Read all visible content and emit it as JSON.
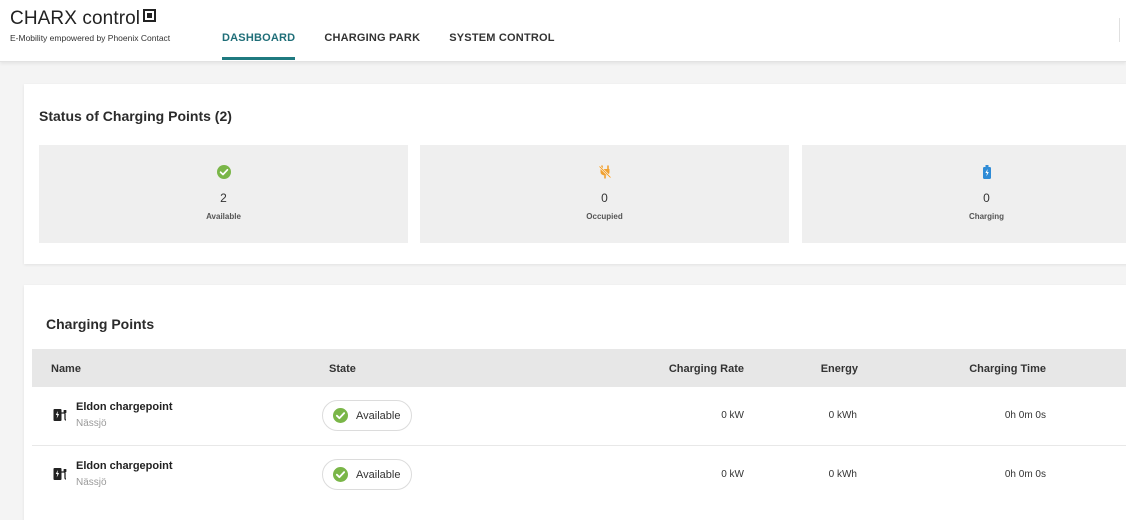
{
  "header": {
    "brand_title": "CHARX control",
    "brand_subtitle": "E-Mobility empowered by Phoenix Contact",
    "tabs": [
      {
        "label": "DASHBOARD",
        "active": true
      },
      {
        "label": "CHARGING PARK",
        "active": false
      },
      {
        "label": "SYSTEM CONTROL",
        "active": false
      }
    ]
  },
  "status": {
    "title": "Status of Charging Points (2)",
    "tiles": [
      {
        "icon": "check-circle-icon",
        "value": "2",
        "label": "Available",
        "color": "#7ab648"
      },
      {
        "icon": "occupied-plug-icon",
        "value": "0",
        "label": "Occupied",
        "color": "#f0a030"
      },
      {
        "icon": "battery-charging-icon",
        "value": "0",
        "label": "Charging",
        "color": "#2e8bd6"
      }
    ]
  },
  "charging_points": {
    "title": "Charging Points",
    "columns": [
      "Name",
      "State",
      "Charging Rate",
      "Energy",
      "Charging Time"
    ],
    "rows": [
      {
        "name": "Eldon chargepoint",
        "location": "Nässjö",
        "state": "Available",
        "rate": "0 kW",
        "energy": "0 kWh",
        "time": "0h 0m 0s"
      },
      {
        "name": "Eldon chargepoint",
        "location": "Nässjö",
        "state": "Available",
        "rate": "0 kW",
        "energy": "0 kWh",
        "time": "0h 0m 0s"
      }
    ]
  },
  "colors": {
    "accent": "#1f7a80",
    "available": "#7ab648",
    "occupied": "#f0a030",
    "charging": "#2e8bd6"
  }
}
